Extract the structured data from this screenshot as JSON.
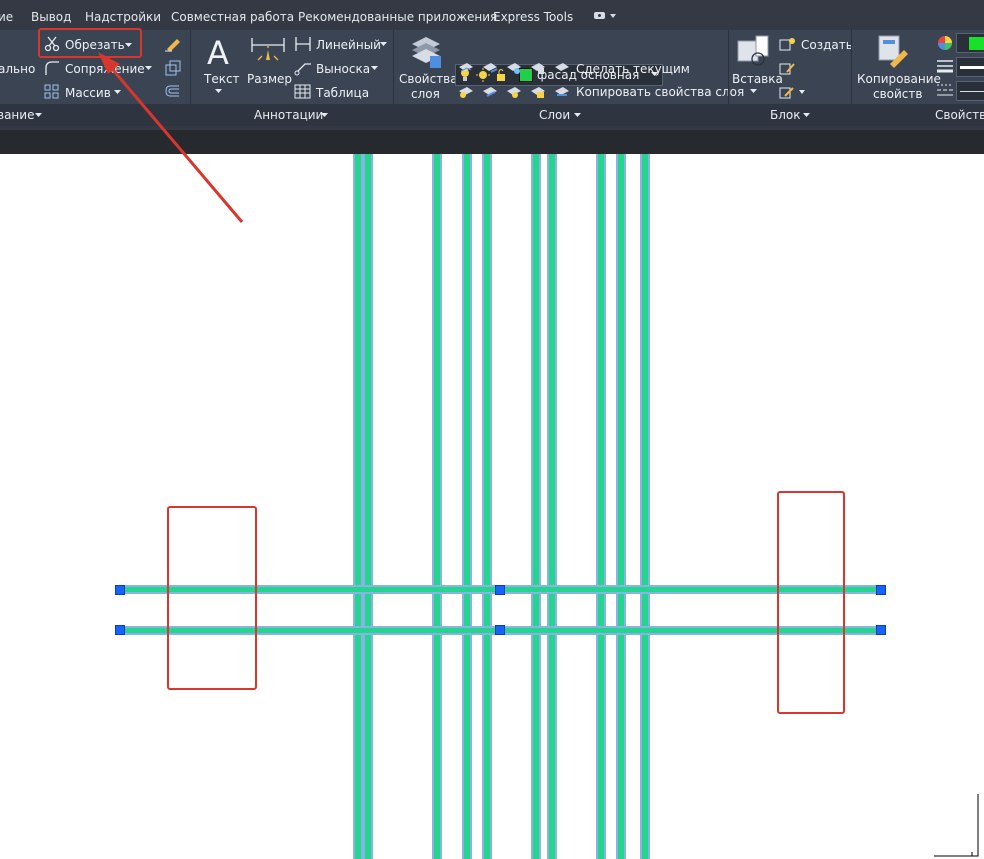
{
  "menu": {
    "items": [
      "ие",
      "Вывод",
      "Надстройки",
      "Совместная работа",
      "Рекомендованные приложения",
      "Express Tools"
    ]
  },
  "modify_panel": {
    "trim_label": "Обрезать",
    "fillet_label": "Сопряжение",
    "array_label": "Массив",
    "partial_label": "ально",
    "title": "вание"
  },
  "annotation_panel": {
    "text_label": "Текст",
    "dimension_label": "Размер",
    "linear_label": "Линейный",
    "leader_label": "Выноска",
    "table_label": "Таблица",
    "title": "Аннотации"
  },
  "layers_panel": {
    "properties_label_line1": "Свойства",
    "properties_label_line2": "слоя",
    "current_layer": "фасад основная",
    "current_layer_color": "#21d04a",
    "make_current_label": "Сделать текущим",
    "copy_props_label": "Копировать свойства слоя",
    "title": "Слои"
  },
  "block_panel": {
    "insert_label": "Вставка",
    "create_label": "Создать",
    "title": "Блок"
  },
  "properties_panel": {
    "match_label_line1": "Копирование",
    "match_label_line2": "свойств",
    "color_swatch": "#19e12a",
    "title": "Свойства"
  },
  "colors": {
    "accent_red": "#d9362d",
    "line_green": "#25d48d",
    "line_blue": "#8bb2e6",
    "grip_blue": "#1664ff"
  }
}
